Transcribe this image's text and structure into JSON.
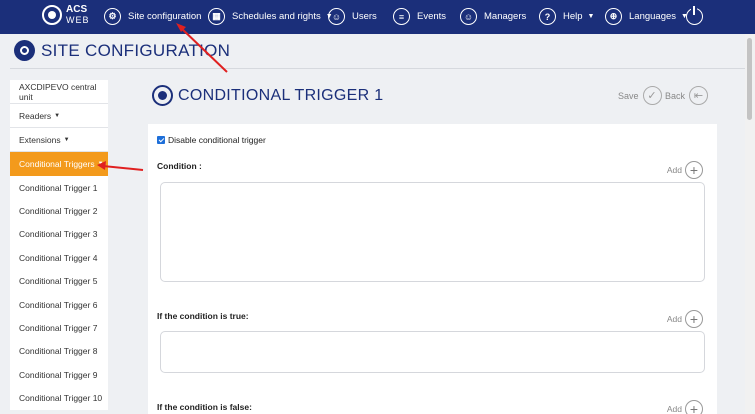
{
  "brand": {
    "line1": "ACS",
    "line2": "WEB"
  },
  "nav": {
    "site_configuration": "Site configuration",
    "schedules_rights": "Schedules and rights",
    "users": "Users",
    "events": "Events",
    "managers": "Managers",
    "help": "Help",
    "languages": "Languages"
  },
  "page": {
    "title": "SITE CONFIGURATION"
  },
  "sidebar": {
    "items": [
      {
        "label": "AXCDIPEVO central unit"
      },
      {
        "label": "Readers"
      },
      {
        "label": "Extensions"
      },
      {
        "label": "Conditional Triggers"
      }
    ],
    "subitems": [
      "Conditional Trigger 1",
      "Conditional Trigger 2",
      "Conditional Trigger 3",
      "Conditional Trigger 4",
      "Conditional Trigger 5",
      "Conditional Trigger 6",
      "Conditional Trigger 7",
      "Conditional Trigger 8",
      "Conditional Trigger 9",
      "Conditional Trigger 10"
    ]
  },
  "main": {
    "title": "CONDITIONAL TRIGGER 1",
    "save_label": "Save",
    "back_label": "Back",
    "disable_label": "Disable conditional trigger",
    "disable_checked": true,
    "condition_label": "Condition :",
    "true_label": "If the condition is true:",
    "false_label": "If the condition is false:",
    "add_label": "Add"
  },
  "colors": {
    "navbar": "#1b2f7a",
    "accent": "#f39a1c",
    "annotation": "#e02020"
  }
}
